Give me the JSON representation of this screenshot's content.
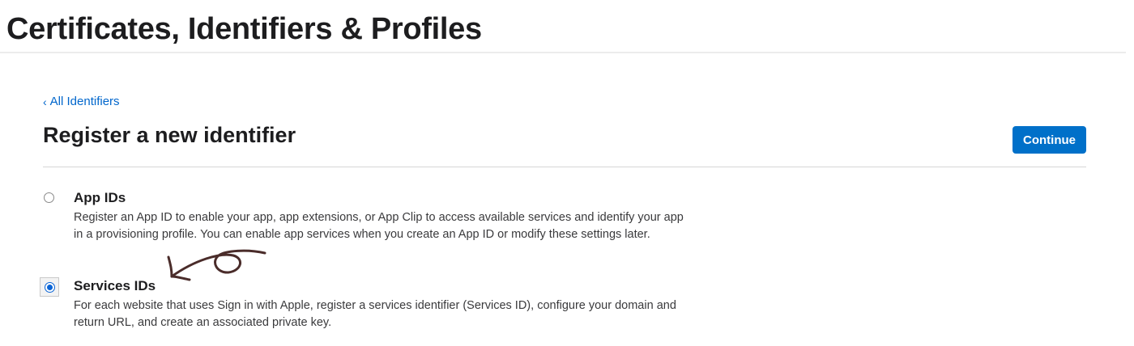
{
  "header": {
    "title": "Certificates, Identifiers & Profiles"
  },
  "nav": {
    "back_chevron": "‹",
    "back_label": "All Identifiers"
  },
  "main": {
    "title": "Register a new identifier",
    "continue_label": "Continue",
    "options": [
      {
        "title": "App IDs",
        "description": "Register an App ID to enable your app, app extensions, or App Clip to access available services and identify your app in a provisioning profile. You can enable app services when you create an App ID or modify these settings later.",
        "selected": false
      },
      {
        "title": "Services IDs",
        "description": "For each website that uses Sign in with Apple, register a services identifier (Services ID), configure your domain and return URL, and create an associated private key.",
        "selected": true
      }
    ]
  },
  "colors": {
    "accent": "#0070c9",
    "link": "#0066cc",
    "annotation": "#4a2c2a"
  },
  "annotation": {
    "icon": "hand-drawn-arrow-icon"
  }
}
